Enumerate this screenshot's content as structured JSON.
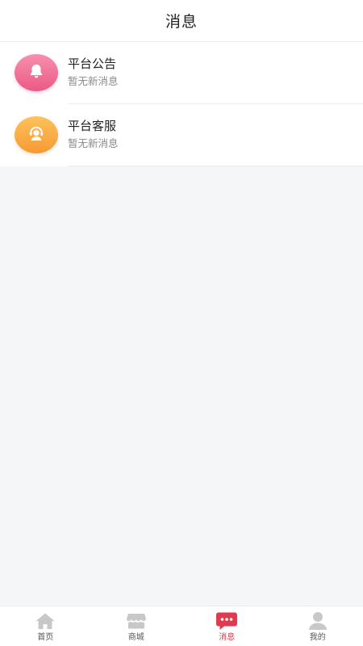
{
  "header": {
    "title": "消息"
  },
  "messages": [
    {
      "title": "平台公告",
      "subtitle": "暂无新消息",
      "icon": "bell-icon",
      "color": "#ee6a90"
    },
    {
      "title": "平台客服",
      "subtitle": "暂无新消息",
      "icon": "customer-service-icon",
      "color": "#f7a63c"
    }
  ],
  "tabbar": {
    "items": [
      {
        "label": "首页",
        "icon": "home-icon",
        "active": false
      },
      {
        "label": "商城",
        "icon": "shop-icon",
        "active": false
      },
      {
        "label": "消息",
        "icon": "message-icon",
        "active": true
      },
      {
        "label": "我的",
        "icon": "user-icon",
        "active": false
      }
    ],
    "active_color": "#e03a4e",
    "inactive_color": "#c8c8c8"
  }
}
